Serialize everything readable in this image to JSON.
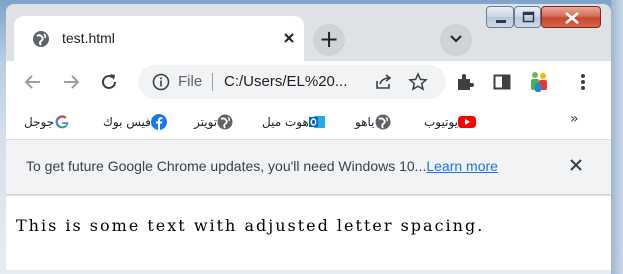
{
  "window": {
    "tab_title": "test.html",
    "new_tab_glyph": "+",
    "controls": [
      "minimize-icon",
      "maximize-icon",
      "close-icon"
    ]
  },
  "toolbar": {
    "file_label": "File",
    "url": "C:/Users/EL%20...",
    "icons": [
      "back-icon",
      "forward-icon",
      "reload-icon",
      "info-icon",
      "share-icon",
      "star-icon",
      "extensions-icon",
      "side-panel-icon",
      "profile-icon",
      "menu-icon"
    ]
  },
  "bookmarks": {
    "items": [
      {
        "label": "جوجل",
        "icon": "google-icon"
      },
      {
        "label": "فيس بوك",
        "icon": "facebook-icon"
      },
      {
        "label": "تويتر",
        "icon": "globe-icon"
      },
      {
        "label": "هوت ميل",
        "icon": "outlook-icon"
      },
      {
        "label": "ياهو",
        "icon": "globe-icon"
      },
      {
        "label": "يوتيوب",
        "icon": "youtube-icon"
      }
    ],
    "overflow": "»"
  },
  "infobar": {
    "message": "To get future Google Chrome updates, you'll need Windows 10...",
    "link": "Learn more",
    "close_icon": "close-icon"
  },
  "page": {
    "text": "This is some text with adjusted letter spacing."
  },
  "colors": {
    "link": "#1a73e8",
    "frame": "#dee1e6",
    "close_button": "#c8462c",
    "youtube": "#ff0000",
    "facebook": "#1877f2",
    "outlook": "#0a64c2"
  }
}
